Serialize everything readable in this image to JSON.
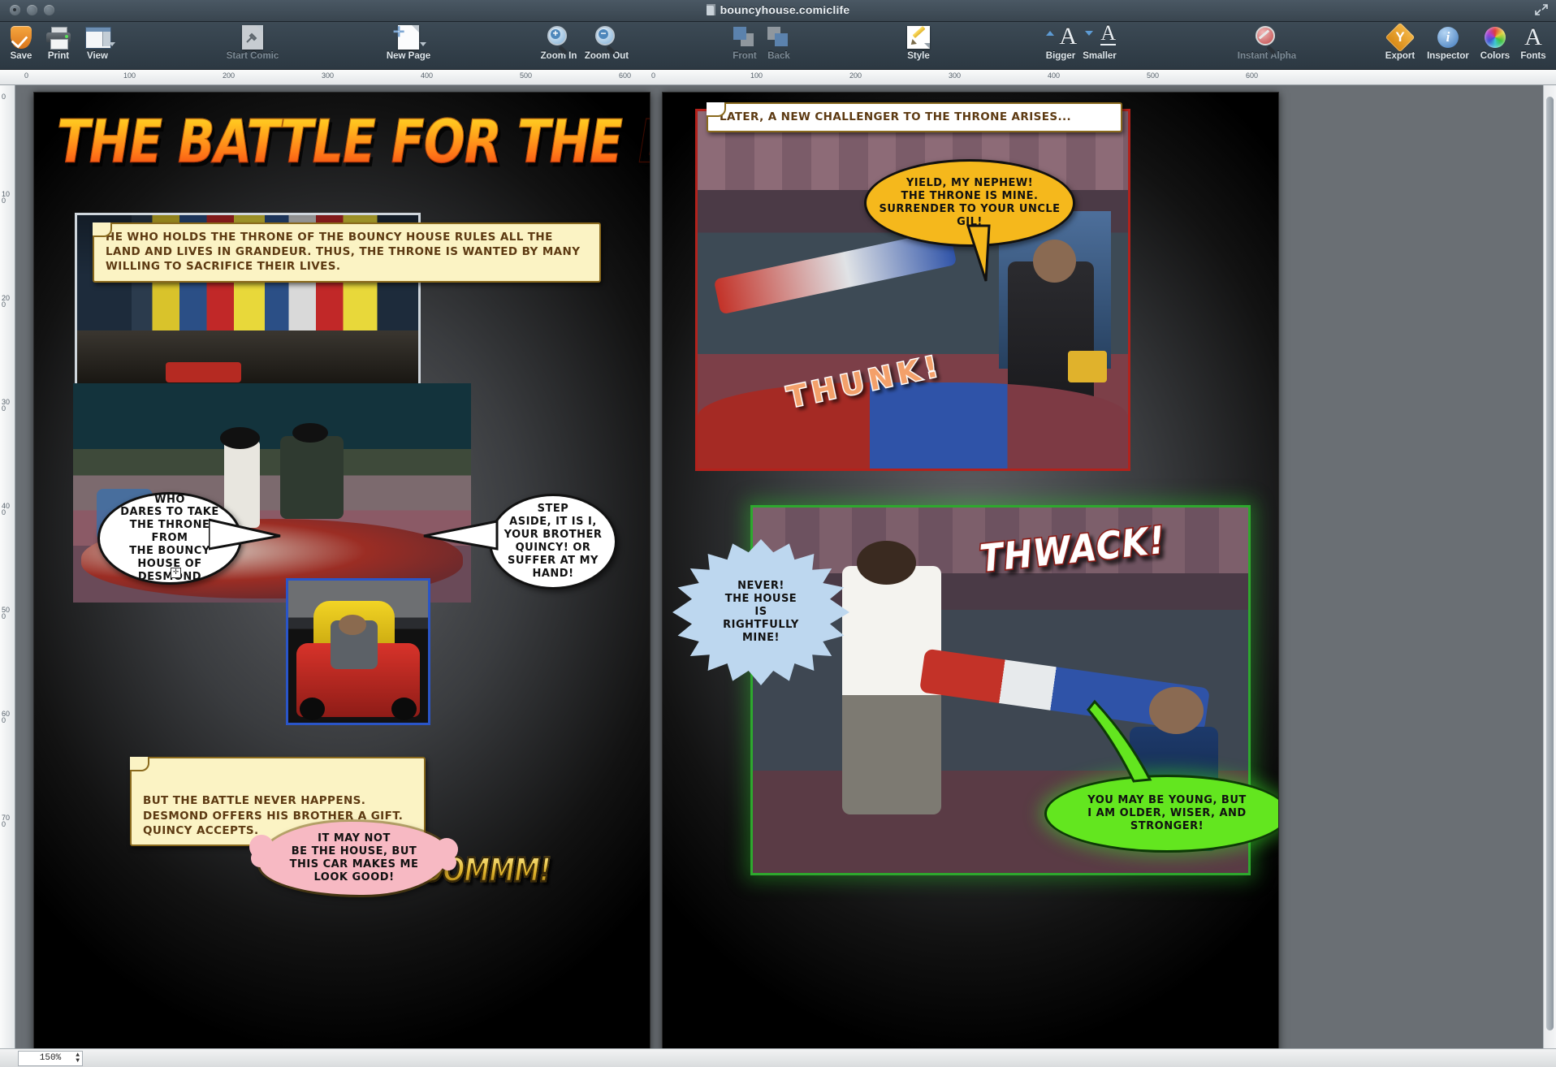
{
  "window": {
    "document_title": "bouncyhouse.comiclife",
    "traffic_lights": [
      "close",
      "minimize",
      "zoom"
    ]
  },
  "toolbar": {
    "items": [
      {
        "name": "save",
        "label": "Save",
        "icon": "shield-check-icon",
        "enabled": true
      },
      {
        "name": "print",
        "label": "Print",
        "icon": "printer-icon",
        "enabled": true
      },
      {
        "name": "view",
        "label": "View",
        "icon": "view-layout-icon",
        "enabled": true
      },
      {
        "name": "start-comic",
        "label": "Start Comic",
        "icon": "hammer-document-icon",
        "enabled": false
      },
      {
        "name": "new-page",
        "label": "New Page",
        "icon": "new-page-icon",
        "enabled": true
      },
      {
        "name": "zoom-in",
        "label": "Zoom In",
        "icon": "magnifier-plus-icon",
        "enabled": true
      },
      {
        "name": "zoom-out",
        "label": "Zoom Out",
        "icon": "magnifier-minus-icon",
        "enabled": true
      },
      {
        "name": "front",
        "label": "Front",
        "icon": "bring-front-icon",
        "enabled": false
      },
      {
        "name": "back",
        "label": "Back",
        "icon": "send-back-icon",
        "enabled": false
      },
      {
        "name": "style",
        "label": "Style",
        "icon": "pencil-style-icon",
        "enabled": true
      },
      {
        "name": "bigger",
        "label": "Bigger",
        "icon": "font-bigger-icon",
        "enabled": true
      },
      {
        "name": "smaller",
        "label": "Smaller",
        "icon": "font-smaller-icon",
        "enabled": true
      },
      {
        "name": "instant-alpha",
        "label": "Instant Alpha",
        "icon": "instant-alpha-icon",
        "enabled": false
      },
      {
        "name": "export",
        "label": "Export",
        "icon": "export-diamond-icon",
        "enabled": true
      },
      {
        "name": "inspector",
        "label": "Inspector",
        "icon": "info-circle-icon",
        "enabled": true
      },
      {
        "name": "colors",
        "label": "Colors",
        "icon": "color-wheel-icon",
        "enabled": true
      },
      {
        "name": "fonts",
        "label": "Fonts",
        "icon": "font-a-icon",
        "enabled": true
      }
    ]
  },
  "rulers": {
    "horizontal_ticks": [
      "0",
      "100",
      "200",
      "300",
      "400",
      "500",
      "600",
      "0",
      "100",
      "200",
      "300",
      "400",
      "500",
      "600"
    ],
    "vertical_ticks": [
      "0",
      "100",
      "200",
      "300",
      "400",
      "500",
      "600",
      "700"
    ]
  },
  "status": {
    "zoom_level": "150%"
  },
  "comic": {
    "title": "THE BATTLE FOR THE BOUNCY HOUSE",
    "left_page": {
      "caption_intro": "HE WHO HOLDS THE THRONE OF THE BOUNCY HOUSE RULES ALL THE LAND AND LIVES IN GRANDEUR. THUS, THE THRONE IS WANTED BY MANY WILLING TO SACRIFICE THEIR LIVES.",
      "balloon_who": "WHO\nDARES TO TAKE\nTHE THRONE FROM\nTHE BOUNCY\nHOUSE OF\nDESMOND",
      "balloon_step_aside": "STEP\nASIDE, IT IS I,\nYOUR BROTHER\nQUINCY! OR\nSUFFER AT MY\nHAND!",
      "caption_gift": "BUT THE BATTLE NEVER HAPPENS.\nDESMOND OFFERS HIS BROTHER A GIFT.\nQUINCY ACCEPTS.",
      "balloon_car": "IT MAY NOT\nBE THE HOUSE, BUT\nTHIS CAR MAKES ME\nLOOK GOOD!",
      "sfx_vrroom": "VRRROOOOMMM!"
    },
    "right_page": {
      "caption_later": "LATER, A NEW CHALLENGER TO THE THRONE ARISES...",
      "balloon_yield": "YIELD, MY NEPHEW!\nTHE THRONE IS MINE.\nSURRENDER TO YOUR UNCLE\nGIL!",
      "sfx_thunk": "THUNK!",
      "sfx_thwack": "THWACK!",
      "balloon_never": "NEVER!\nTHE HOUSE\nIS\nRIGHTFULLY\nMINE!",
      "balloon_older": "YOU MAY BE YOUNG, BUT\nI AM OLDER, WISER, AND\nSTRONGER!"
    }
  },
  "colors": {
    "title_gradient_top": "#ffe23c",
    "title_gradient_bottom": "#e61f10",
    "caption_fill": "#fbf3c4",
    "caption_border": "#8a6a1e",
    "balloon_yellow": "#f5b81c",
    "balloon_green": "#63e61f",
    "balloon_pink": "#f7b9c3",
    "burst_blue": "#bdd7ef",
    "frame_red": "#b3221c",
    "frame_green": "#2ea82e",
    "frame_blue": "#2a55c8",
    "toolbar_bg": "#2c3842"
  }
}
